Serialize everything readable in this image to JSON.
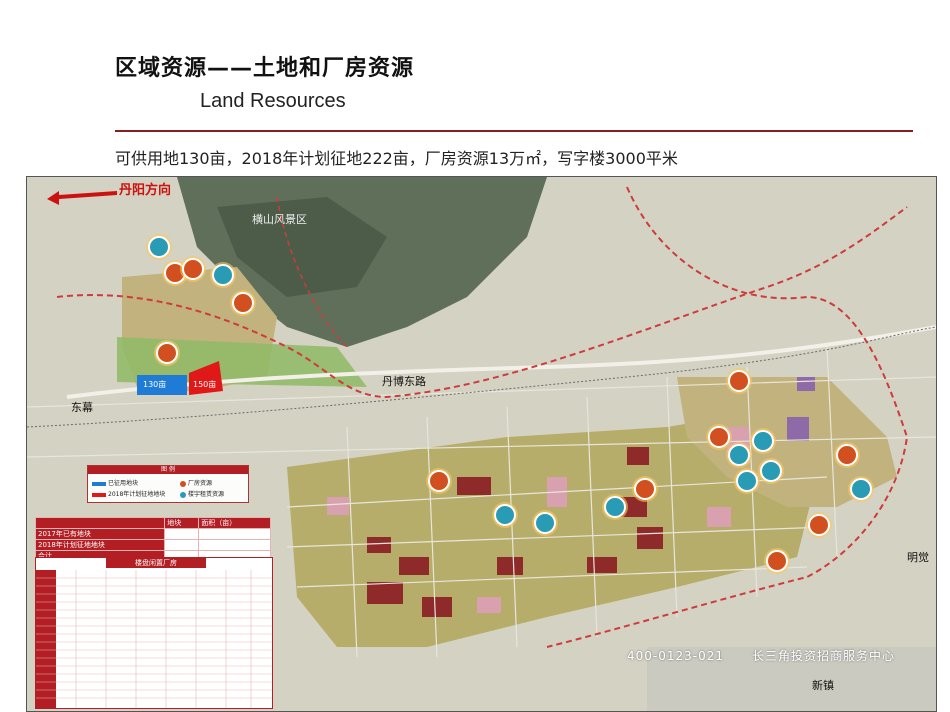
{
  "header": {
    "title_cn": "区域资源——土地和厂房资源",
    "title_en": "Land Resources",
    "summary": "可供用地130亩，2018年计划征地222亩，厂房资源13万㎡，写字楼3000平米"
  },
  "map": {
    "direction_label": "丹阳方向",
    "labels": {
      "scenic": "横山风景区",
      "road_main": "丹博东路",
      "east": "东幕",
      "mingjue": "明觉",
      "xinzhen": "新镇"
    },
    "lots": {
      "lot_130": "130亩",
      "lot_150": "150亩"
    },
    "legend": {
      "title": "图 例",
      "items": [
        "已征用地块",
        "2018年计划征地地块",
        "厂房资源",
        "楼宇租赁资源"
      ]
    },
    "land_table": {
      "header": [
        "地块",
        "面积（亩）"
      ],
      "rows": [
        [
          "2017年已有地块",
          ""
        ],
        [
          "2018年计划征地地块",
          ""
        ],
        [
          "合计",
          ""
        ]
      ]
    },
    "factory_table": {
      "title": "楼盘闲置厂房"
    },
    "watermark": {
      "phone": "400-0123-021",
      "company": "长三角投资招商服务中心"
    },
    "colors": {
      "mountain": "#5f6f5a",
      "urban": "#b6ad6a",
      "industrial": "#8e2a2a",
      "pink": "#d9a0b0",
      "road_red": "#cf3b3b",
      "green_belt": "#7fb35a",
      "lot_blue": "#1f7bd6",
      "lot_red": "#e01818"
    },
    "icons": [
      "factory-pin-icon",
      "office-pin-icon",
      "direction-arrow-icon"
    ]
  }
}
